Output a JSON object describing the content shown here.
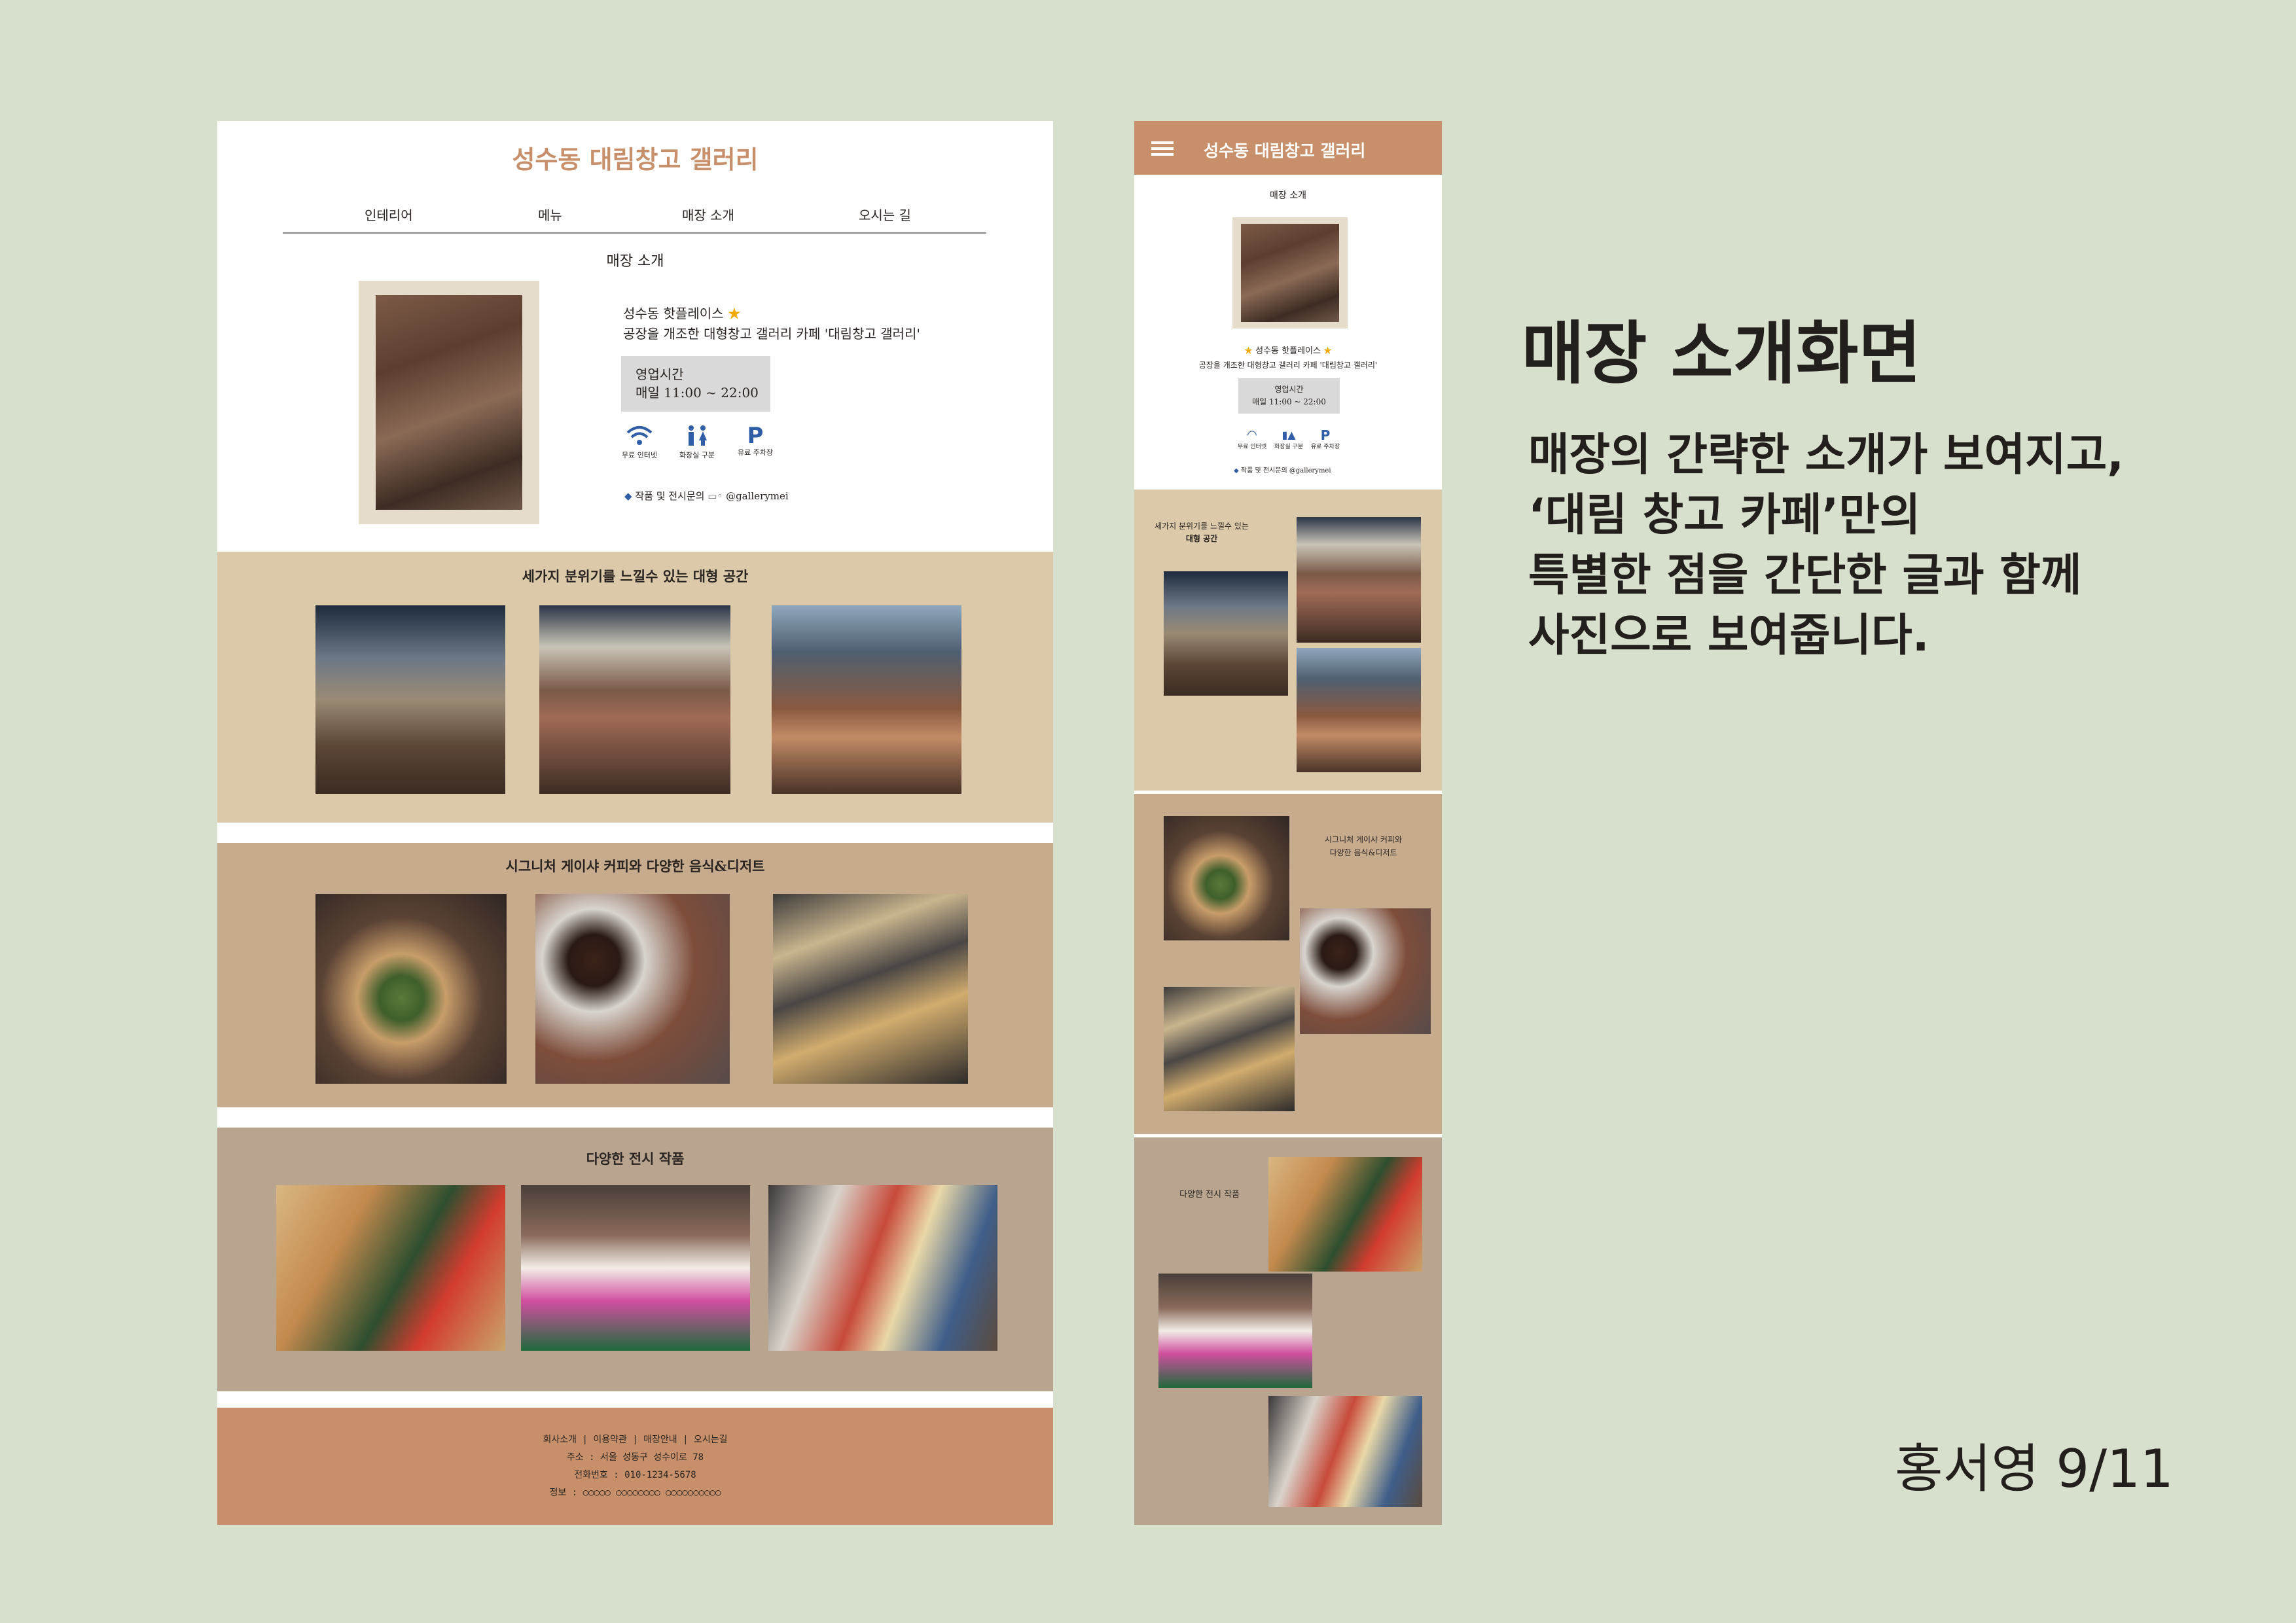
{
  "desktop": {
    "site_title": "성수동 대림창고 갤러리",
    "nav": [
      "인테리어",
      "메뉴",
      "매장 소개",
      "오시는 길"
    ],
    "section_title": "매장 소개",
    "hotplace": "성수동 핫플레이스",
    "description": "공장을 개조한 대형창고 갤러리 카페 '대림창고 갤러리'",
    "hours_label": "영업시간",
    "hours_value": "매일 11:00 ~ 22:00",
    "amenities": [
      "무료 인터넷",
      "화장실 구분",
      "유료 주차장"
    ],
    "inquiry_label": "작품 및 전시문의",
    "instagram": "@gallerymei",
    "band1_title": "세가지 분위기를 느낄수 있는 대형 공간",
    "band2_title": "시그니처 게이샤 커피와 다양한 음식&디저트",
    "band3_title": "다양한 전시 작품",
    "footer": {
      "links": "회사소개 | 이용약관 | 매장안내 | 오시는길",
      "address": "주소 : 서울 성동구 성수이로 78",
      "phone": "전화번호 : 010-1234-5678",
      "info": "정보 : ○○○○○ ○○○○○○○○ ○○○○○○○○○○"
    }
  },
  "mobile": {
    "site_title": "성수동 대림창고 갤러리",
    "section_title": "매장 소개",
    "hotplace": "성수동 핫플레이스",
    "description": "공장을 개조한 대형창고 갤러리 카페 '대림창고 갤러리'",
    "hours_label": "영업시간",
    "hours_value": "매일 11:00 ~ 22:00",
    "amenities": [
      "무료 인터넷",
      "화장실 구분",
      "유료 주차장"
    ],
    "inquiry_label": "작품 및 전시문의",
    "instagram": "@gallerymei",
    "band1_title_line1": "세가지 분위기를 느낄수 있는",
    "band1_title_line2": "대형 공간",
    "band2_title_line1": "시그니처 게이샤 커피와",
    "band2_title_line2": "다양한 음식&디저트",
    "band3_title": "다양한 전시 작품"
  },
  "annotation": {
    "heading": "매장 소개화면",
    "body": [
      "매장의 간략한 소개가 보여지고,",
      "‘대림 창고 카페’만의",
      "특별한 점을 간단한 글과 함께",
      "사진으로 보여줍니다."
    ],
    "author": "홍서영 9/11"
  },
  "colors": {
    "background": "#d7e0cc",
    "accent": "#c8906a",
    "band1": "#dcc9a9",
    "band2": "#c7ab8d",
    "band3": "#b9a58f",
    "hours_box": "#d9d9d9",
    "blue_icon": "#2f5da6"
  },
  "icons": [
    "wifi-icon",
    "restroom-icon",
    "parking-icon",
    "diamond-bullet-icon",
    "instagram-icon",
    "star-icon",
    "hamburger-menu-icon"
  ]
}
